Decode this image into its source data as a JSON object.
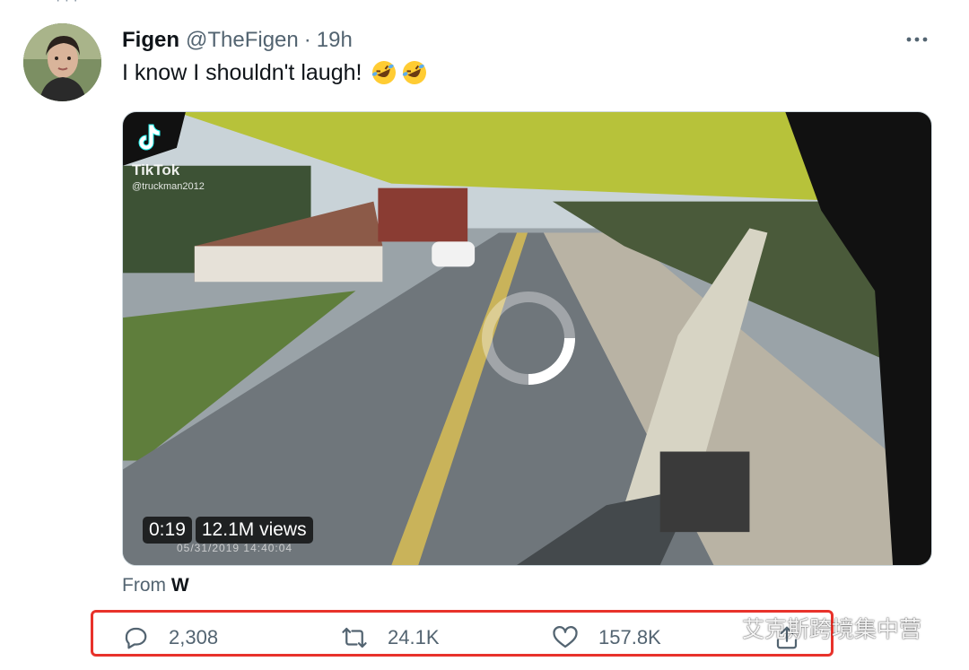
{
  "tweet": {
    "author_name": "Figen",
    "author_handle": "@TheFigen",
    "separator": "·",
    "time_ago": "19h",
    "text": "I know I shouldn't laugh!",
    "emojis": [
      "rolling-on-floor-laughing",
      "rolling-on-floor-laughing"
    ]
  },
  "media": {
    "source_logo_text": "TikTok",
    "source_username": "@truckman2012",
    "duration": "0:19",
    "views": "12.1M views",
    "timestamp_overlay": "05/31/2019  14:40:04"
  },
  "attribution": {
    "prefix": "From",
    "account": "W"
  },
  "actions": {
    "replies": "2,308",
    "retweets": "24.1K",
    "likes": "157.8K"
  },
  "watermark": {
    "text": "艾克斯跨境集中营"
  },
  "colors": {
    "highlight_box": "#e8322b",
    "secondary_text": "#536471"
  }
}
